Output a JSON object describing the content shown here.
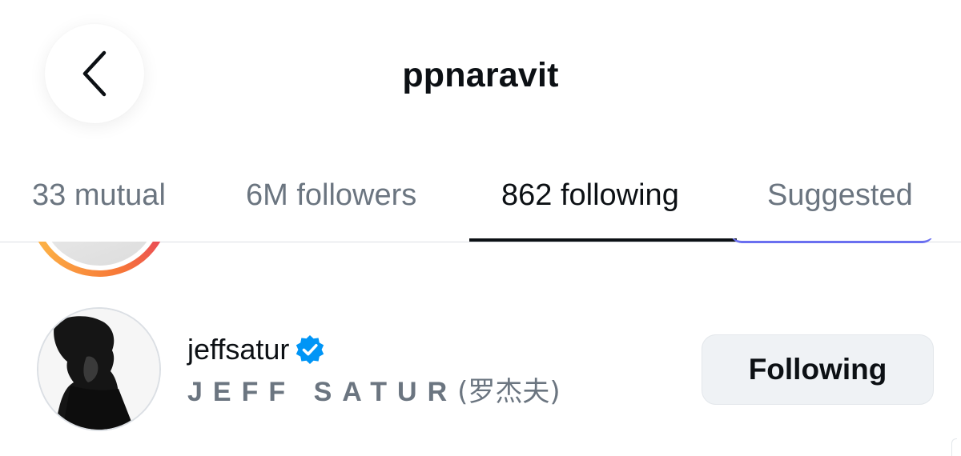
{
  "header": {
    "title": "ppnaravit",
    "back_icon": "chevron-left-icon"
  },
  "tabs": [
    {
      "label": "33 mutual",
      "active": false
    },
    {
      "label": "6M followers",
      "active": false
    },
    {
      "label": "862 following",
      "active": true
    },
    {
      "label": "Suggested",
      "active": false
    }
  ],
  "users": [
    {
      "username": "jeffsatur",
      "verified": true,
      "display_name_latin": "JEFF SATUR",
      "display_name_cjk": "(罗杰夫)",
      "action_label": "Following"
    }
  ],
  "colors": {
    "text_primary": "#0c1014",
    "text_secondary": "#6b7580",
    "verified_blue": "#0095f6",
    "button_bg": "#eff2f5",
    "divider": "#dbdfe4"
  }
}
